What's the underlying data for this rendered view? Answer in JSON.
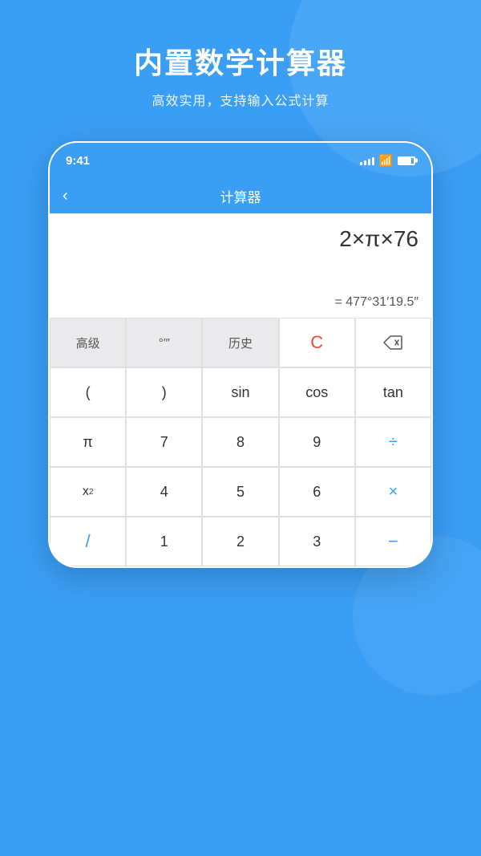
{
  "page": {
    "background_color": "#3a9ef5",
    "header": {
      "title": "内置数学计算器",
      "subtitle": "高效实用，支持输入公式计算"
    }
  },
  "phone": {
    "status_bar": {
      "time": "9:41",
      "signal": "signal",
      "wifi": "wifi",
      "battery": "battery"
    },
    "app_header": {
      "back_label": "‹",
      "title": "计算器"
    },
    "display": {
      "expression": "2×π×76",
      "result": "= 477°31′19.5″"
    },
    "keyboard": {
      "rows": [
        [
          "高级",
          "°′″",
          "历史",
          "C",
          "⌫"
        ],
        [
          "(",
          ")",
          "sin",
          "cos",
          "tan"
        ],
        [
          "π",
          "7",
          "8",
          "9",
          "÷"
        ],
        [
          "x²",
          "4",
          "5",
          "6",
          "×"
        ],
        [
          "/",
          "1",
          "2",
          "3",
          "—"
        ]
      ]
    }
  }
}
